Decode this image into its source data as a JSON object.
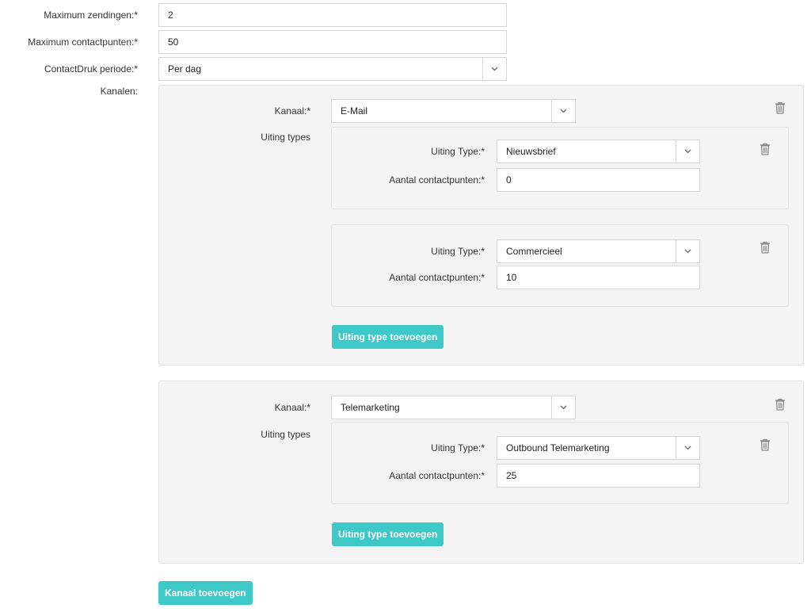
{
  "form": {
    "max_zendingen": {
      "label": "Maximum zendingen:*",
      "value": "2"
    },
    "max_contactpunten": {
      "label": "Maximum contactpunten:*",
      "value": "50"
    },
    "periode": {
      "label": "ContactDruk periode:*",
      "value": "Per dag"
    },
    "kanalen_label": "Kanalen:"
  },
  "kanalen": [
    {
      "kanaal_label": "Kanaal:*",
      "kanaal_value": "E-Mail",
      "uiting_types_label": "Uiting types",
      "uitingen": [
        {
          "type_label": "Uiting Type:*",
          "type_value": "Nieuwsbrief",
          "aantal_label": "Aantal contactpunten:*",
          "aantal_value": "0"
        },
        {
          "type_label": "Uiting Type:*",
          "type_value": "Commercieel",
          "aantal_label": "Aantal contactpunten:*",
          "aantal_value": "10"
        }
      ],
      "add_uiting_label": "Uiting type toevoegen"
    },
    {
      "kanaal_label": "Kanaal:*",
      "kanaal_value": "Telemarketing",
      "uiting_types_label": "Uiting types",
      "uitingen": [
        {
          "type_label": "Uiting Type:*",
          "type_value": "Outbound Telemarketing",
          "aantal_label": "Aantal contactpunten:*",
          "aantal_value": "25"
        }
      ],
      "add_uiting_label": "Uiting type toevoegen"
    }
  ],
  "add_kanaal_label": "Kanaal toevoegen",
  "icons": {
    "delete": "trash-icon",
    "dropdown": "chevron-down-icon"
  },
  "colors": {
    "accent": "#3ec9c8",
    "panel_bg": "#f4f4f4",
    "border": "#d6d6d6"
  }
}
